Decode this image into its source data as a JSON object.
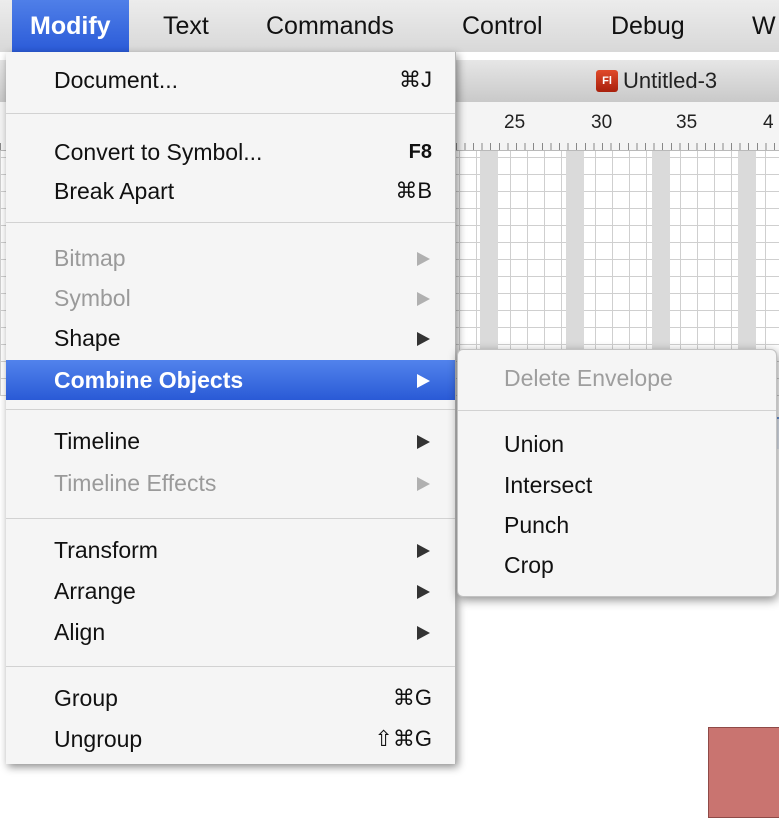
{
  "menubar": {
    "items": [
      {
        "label": "Modify",
        "active": true
      },
      {
        "label": "Text"
      },
      {
        "label": "Commands"
      },
      {
        "label": "Control"
      },
      {
        "label": "Debug"
      },
      {
        "label": "W"
      }
    ]
  },
  "document": {
    "title": "Untitled-3",
    "icon": "flash-document-icon",
    "icon_label": "Fl",
    "ruler_labels": [
      "25",
      "30",
      "35",
      "4"
    ]
  },
  "modify_menu": {
    "items": [
      {
        "label": "Document...",
        "shortcut": "⌘J"
      },
      {
        "label": "Convert to Symbol...",
        "shortcut": "F8"
      },
      {
        "label": "Break Apart",
        "shortcut": "⌘B"
      },
      {
        "label": "Bitmap",
        "disabled": true,
        "submenu": true
      },
      {
        "label": "Symbol",
        "disabled": true,
        "submenu": true
      },
      {
        "label": "Shape",
        "submenu": true
      },
      {
        "label": "Combine Objects",
        "submenu": true,
        "highlighted": true
      },
      {
        "label": "Timeline",
        "submenu": true
      },
      {
        "label": "Timeline Effects",
        "disabled": true,
        "submenu": true
      },
      {
        "label": "Transform",
        "submenu": true
      },
      {
        "label": "Arrange",
        "submenu": true
      },
      {
        "label": "Align",
        "submenu": true
      },
      {
        "label": "Group",
        "shortcut": "⌘G"
      },
      {
        "label": "Ungroup",
        "shortcut": "⇧⌘G"
      }
    ]
  },
  "combine_objects_submenu": {
    "items": [
      {
        "label": "Delete Envelope",
        "disabled": true
      },
      {
        "label": "Union"
      },
      {
        "label": "Intersect"
      },
      {
        "label": "Punch"
      },
      {
        "label": "Crop"
      }
    ]
  },
  "colors": {
    "highlight": "#2f5fdb",
    "disabled_text": "#9a9a9a",
    "shape_fill": "#c97470"
  }
}
